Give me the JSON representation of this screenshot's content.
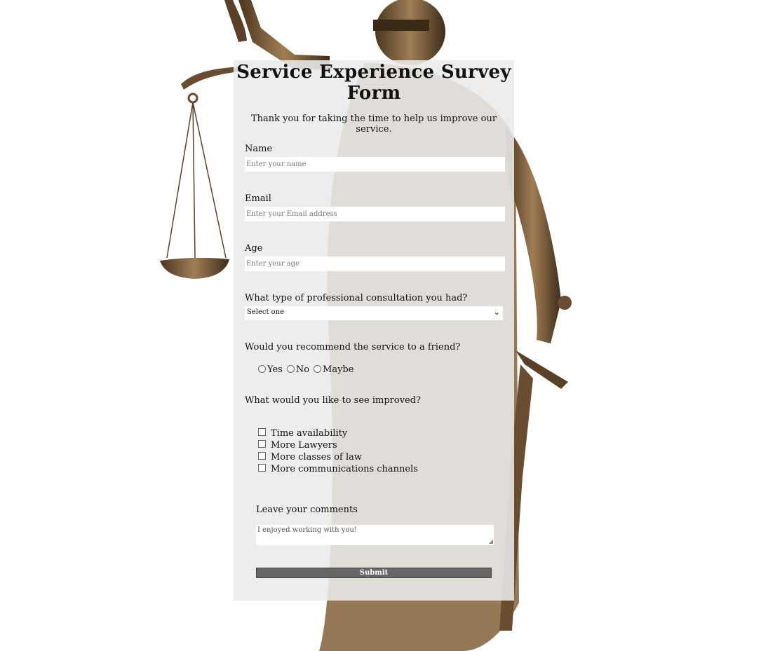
{
  "form": {
    "title_line1": "Service Experience Survey",
    "title_line2": "Form",
    "description": "Thank you for taking the time to help us improve our service.",
    "name": {
      "label": "Name",
      "placeholder": "Enter your name"
    },
    "email": {
      "label": "Email",
      "placeholder": "Enter your Email address"
    },
    "age": {
      "label": "Age",
      "placeholder": "Enter your age"
    },
    "consultation": {
      "label": "What type of professional consultation you had?",
      "selected": "Select one"
    },
    "recommend": {
      "label": "Would you recommend the service to a friend?",
      "options": [
        "Yes",
        "No",
        "Maybe"
      ]
    },
    "improve": {
      "label": "What would you like to see improved?",
      "options": [
        "Time availability",
        "More Lawyers",
        "More classes of law",
        "More communications channels"
      ]
    },
    "comments": {
      "label": "Leave your comments",
      "placeholder": "I enjoyed working with you!"
    },
    "submit_label": "Submit"
  },
  "icons": {
    "dropdown": "chevron-down-icon",
    "background": "lady-justice-statue"
  },
  "colors": {
    "panel": "#ebebeb",
    "submit_bg": "#666666",
    "bronze": "#7a5a3a"
  }
}
